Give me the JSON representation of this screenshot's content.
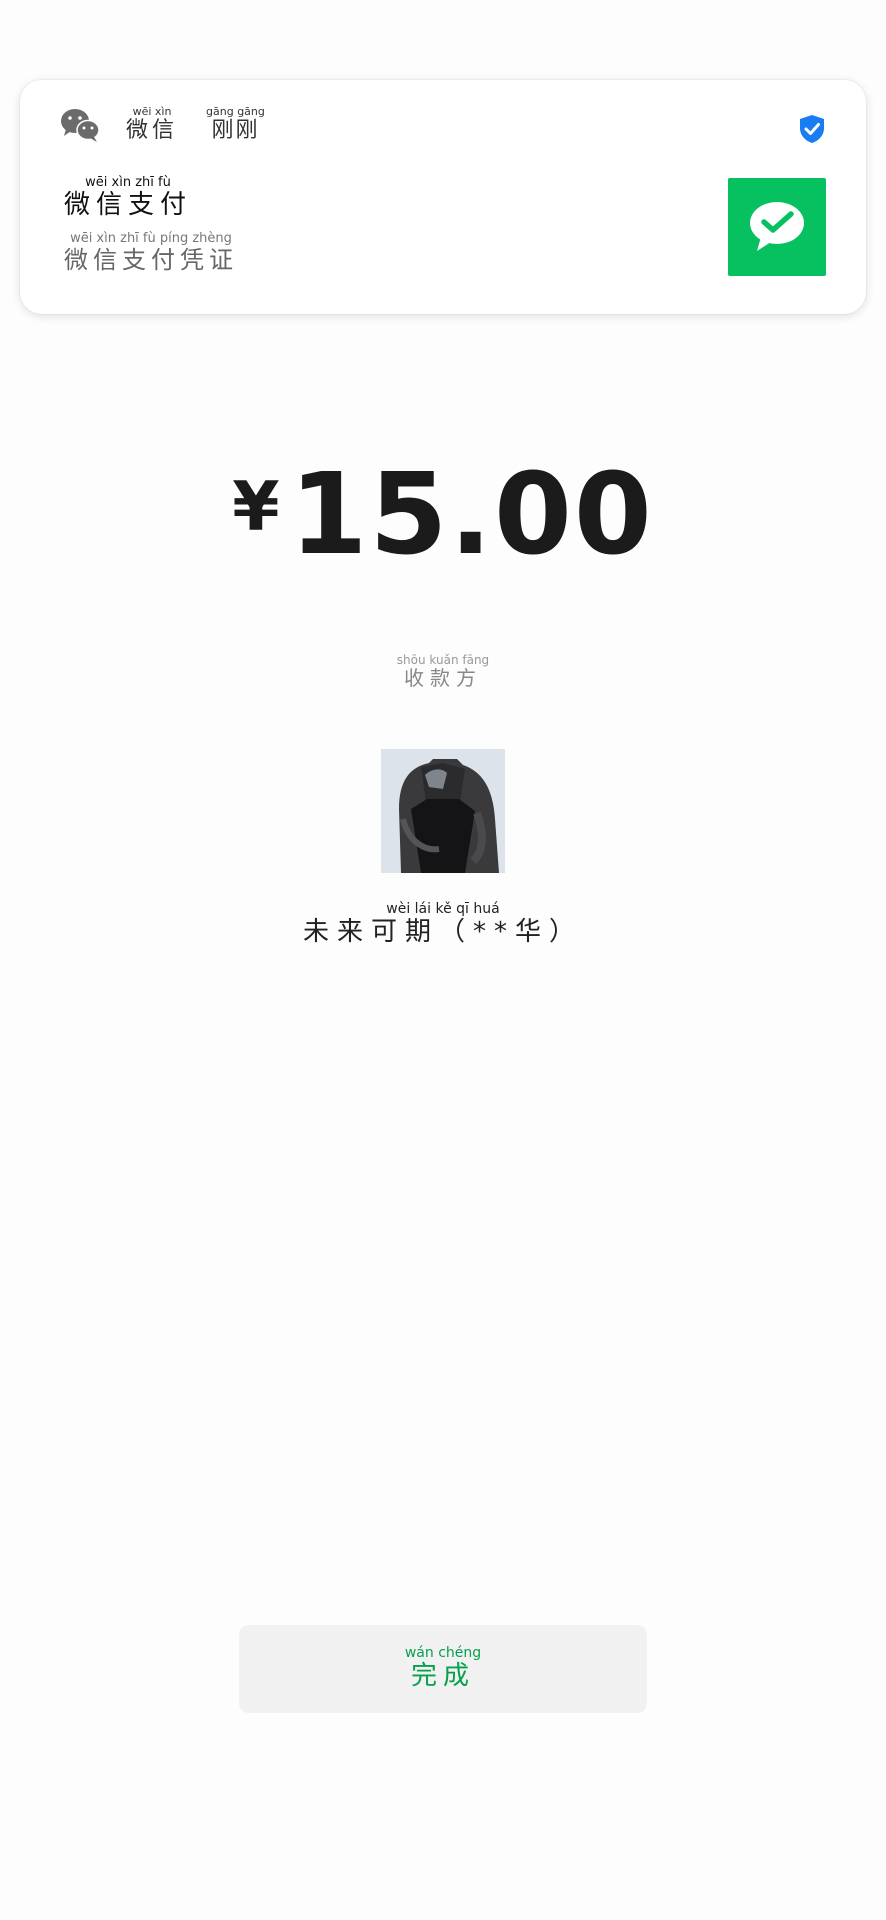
{
  "notification": {
    "app_name": "微信",
    "app_name_pinyin": "wēi xìn",
    "time": "刚刚",
    "time_pinyin": "gāng gāng",
    "title": "微信支付",
    "title_pinyin": "wēi xìn zhī fù",
    "subtitle": "微信支付凭证",
    "subtitle_pinyin": "wēi xìn zhī fù píng zhèng",
    "icons": {
      "app": "wechat-logo-icon",
      "verified": "shield-check-icon",
      "thumb": "wechat-pay-icon"
    },
    "colors": {
      "thumb_bg": "#07c160",
      "shield": "#1a7cf3"
    }
  },
  "payment": {
    "currency_symbol": "¥",
    "amount": "15.00"
  },
  "payee": {
    "label": "收款方",
    "label_pinyin": "shōu kuǎn fāng",
    "name": "未来可期（**华）",
    "name_pinyin": "wèi lái kě qī huá"
  },
  "actions": {
    "done_label": "完成",
    "done_pinyin": "wán chéng",
    "done_color": "#07a04f"
  }
}
